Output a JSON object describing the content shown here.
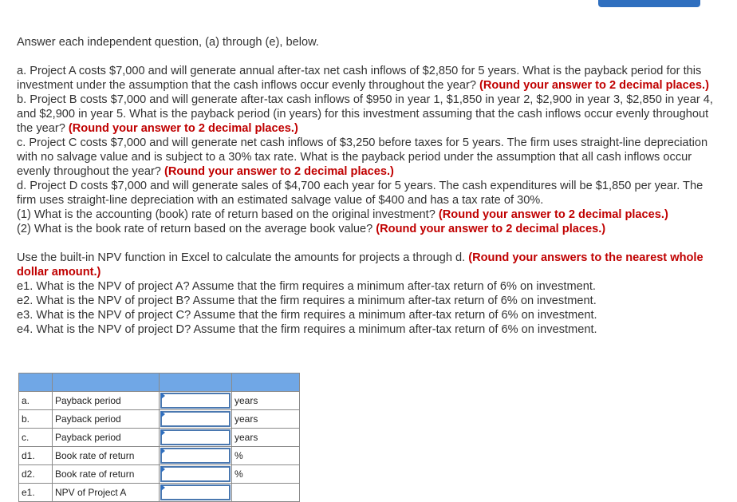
{
  "header": {
    "top_button_label": ""
  },
  "intro": "Answer each independent question, (a) through (e), below.",
  "questions": {
    "a": {
      "text": "a. Project A costs $7,000 and will generate annual after-tax net cash inflows of $2,850 for 5 years. What is the payback period for this investment under the assumption that the cash inflows occur evenly throughout the year? ",
      "note": "(Round your answer to 2 decimal places.)"
    },
    "b": {
      "text": "b. Project B costs $7,000 and will generate after-tax cash inflows of $950 in year 1, $1,850 in year 2, $2,900 in year 3, $2,850 in year 4, and $2,900 in year 5. What is the payback period (in years) for this investment assuming that the cash inflows occur evenly throughout the year? ",
      "note": "(Round your answer to 2 decimal places.)"
    },
    "c": {
      "text": "c. Project C costs $7,000 and will generate net cash inflows of $3,250 before taxes for 5 years. The firm uses straight-line depreciation with no salvage value and is subject to a 30% tax rate. What is the payback period under the assumption that all cash inflows occur evenly throughout the year? ",
      "note": "(Round your answer to 2 decimal places.)"
    },
    "d": {
      "text": "d. Project D costs $7,000 and will generate sales of $4,700 each year for 5 years. The cash expenditures will be $1,850 per year. The firm uses straight-line depreciation with an estimated salvage value of $400 and has a tax rate of 30%."
    },
    "d1": {
      "text": "(1) What is the accounting (book) rate of return based on the original investment? ",
      "note": "(Round your answer to 2 decimal places.)"
    },
    "d2": {
      "text": "(2) What is the book rate of return based on the average book value? ",
      "note": "(Round your answer to 2 decimal places.)"
    },
    "e": {
      "text": "Use the built-in NPV function in Excel to calculate the amounts for projects a through d. ",
      "note": "(Round your answers to the nearest whole dollar amount.)"
    },
    "e1": "e1. What is the NPV of project A? Assume that the firm requires a minimum after-tax return of 6% on investment.",
    "e2": "e2. What is the NPV of project B? Assume that the firm requires a minimum after-tax return of 6% on investment.",
    "e3": "e3. What is the NPV of project C? Assume that the firm requires a minimum after-tax return of 6% on investment.",
    "e4": "e4. What is the NPV of project D? Assume that the firm requires a minimum after-tax return of 6% on investment."
  },
  "answer_table": {
    "rows": [
      {
        "id": "a.",
        "label": "Payback period",
        "value": "",
        "unit": "years"
      },
      {
        "id": "b.",
        "label": "Payback period",
        "value": "",
        "unit": "years"
      },
      {
        "id": "c.",
        "label": "Payback period",
        "value": "",
        "unit": "years"
      },
      {
        "id": "d1.",
        "label": "Book rate of return",
        "value": "",
        "unit": "%"
      },
      {
        "id": "d2.",
        "label": "Book rate of return",
        "value": "",
        "unit": "%"
      },
      {
        "id": "e1.",
        "label": "NPV of Project A",
        "value": "",
        "unit": ""
      }
    ]
  },
  "colors": {
    "accent": "#2f6fbf",
    "header_fill": "#70a7e6",
    "emphasis": "#c00000"
  }
}
